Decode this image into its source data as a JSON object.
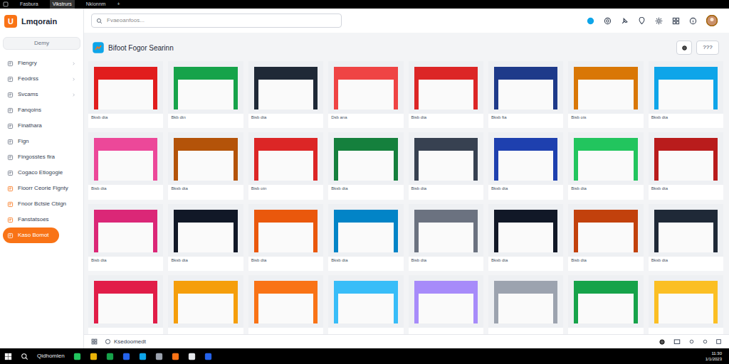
{
  "window": {
    "tabs": [
      {
        "label": "Fasbura",
        "selected": false
      },
      {
        "label": "Vikstrurs",
        "selected": true
      },
      {
        "label": "Nkionnm",
        "selected": false
      }
    ],
    "new_tab": "+"
  },
  "sidebar": {
    "logo_letter": "U",
    "app_name": "Lmqorain",
    "button": "Demy",
    "items": [
      {
        "label": "Fiengry",
        "chevron": true,
        "selected": false
      },
      {
        "label": "Feodrss",
        "chevron": true,
        "selected": false
      },
      {
        "label": "Svcams",
        "chevron": true,
        "selected": false
      },
      {
        "label": "Fanqoins",
        "chevron": false,
        "selected": false
      },
      {
        "label": "Finathara",
        "chevron": false,
        "selected": false
      },
      {
        "label": "Fign",
        "chevron": false,
        "selected": false
      },
      {
        "label": "Fingosstes fira",
        "chevron": false,
        "selected": false
      },
      {
        "label": "Cogaco Etiogogie",
        "chevron": false,
        "selected": false
      },
      {
        "label": "Fioorr Ceorie Fignty",
        "chevron": false,
        "selected": false
      },
      {
        "label": "Fnoor Bctsie Cbign",
        "chevron": false,
        "selected": false
      },
      {
        "label": "Fanstatsoes",
        "chevron": false,
        "selected": false
      },
      {
        "label": "Kaso Bomot",
        "chevron": false,
        "selected": true
      }
    ]
  },
  "search": {
    "placeholder": "Fvaeoanfoos..."
  },
  "header": {
    "title": "Bifoot Fogor Searinn",
    "button": "???"
  },
  "tiles": [
    {
      "caption": "Bksb dta"
    },
    {
      "caption": "Bkb dtn"
    },
    {
      "caption": "Bisb dta"
    },
    {
      "caption": "Dsb ana"
    },
    {
      "caption": "Bisb dta"
    },
    {
      "caption": "Bksb fta"
    },
    {
      "caption": "Bisb ots"
    },
    {
      "caption": "Bksb dta"
    },
    {
      "caption": "Bisb dta"
    },
    {
      "caption": "Bksb dta"
    },
    {
      "caption": "Bisb otn"
    },
    {
      "caption": "Bksb dta"
    },
    {
      "caption": "Bisb dta"
    },
    {
      "caption": "Bksb dta"
    },
    {
      "caption": "Bisb dta"
    },
    {
      "caption": "Bksb dta"
    },
    {
      "caption": "Bisb dta"
    },
    {
      "caption": "Bksb dta"
    },
    {
      "caption": "Bisb dta"
    },
    {
      "caption": "Bksb dta"
    },
    {
      "caption": "Bisb dta"
    },
    {
      "caption": "Bksb dta"
    },
    {
      "caption": "Bisb dta"
    },
    {
      "caption": "Bksb dta"
    },
    {},
    {},
    {},
    {},
    {},
    {},
    {},
    {}
  ],
  "bottom_bar": {
    "label": "Ksedoomedt"
  },
  "taskbar": {
    "search": "Qidhomlen",
    "time": "11:30",
    "date": "1/1/2023"
  }
}
